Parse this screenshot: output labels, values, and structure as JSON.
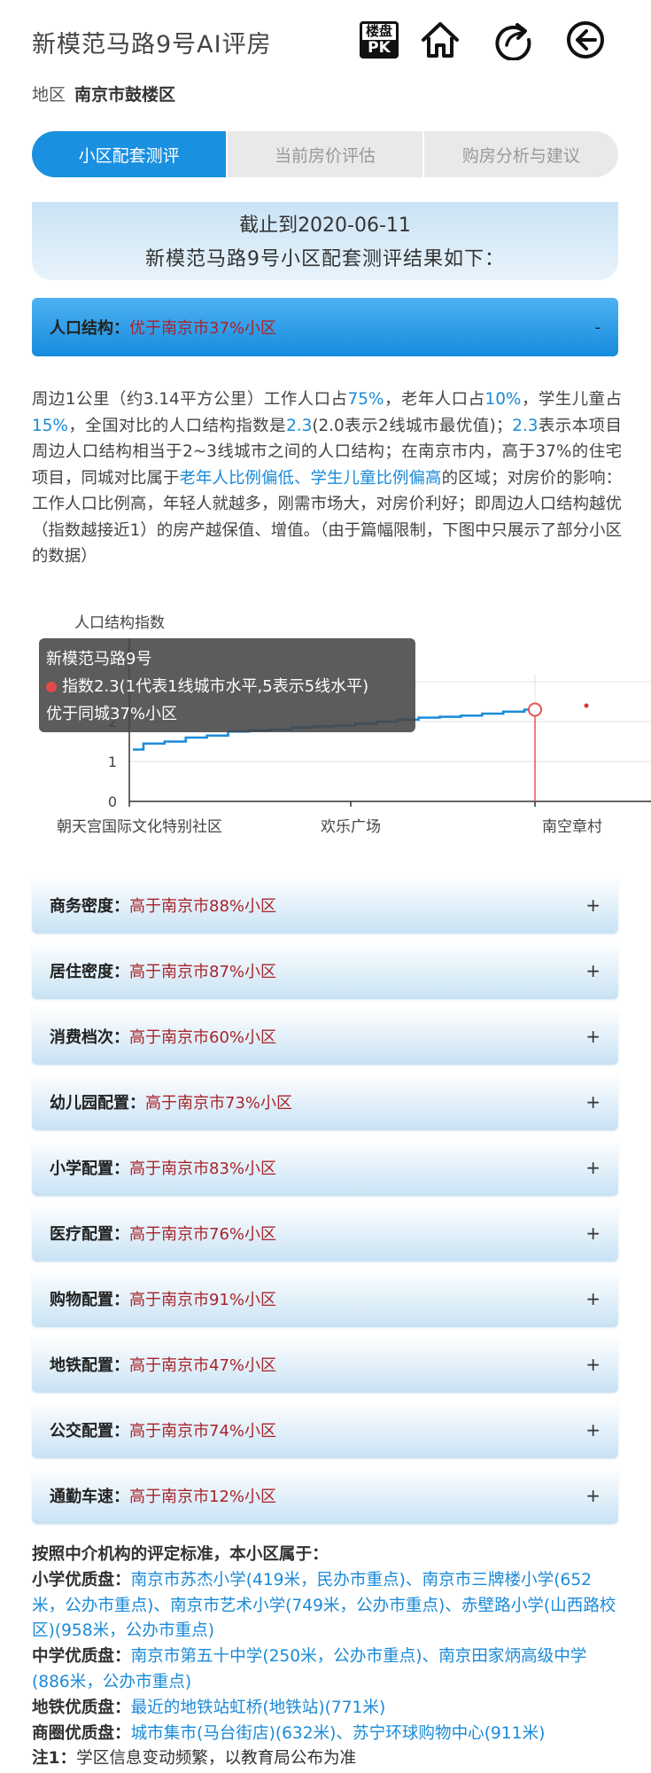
{
  "header": {
    "title": "新模范马路9号AI评房",
    "pk_icon_top": "楼盘",
    "pk_icon_bottom": "PK",
    "icons": [
      "pk-icon",
      "home-icon",
      "share-icon",
      "back-icon"
    ]
  },
  "region": {
    "label": "地区",
    "value": "南京市鼓楼区"
  },
  "tabs": [
    {
      "label": "小区配套测评",
      "active": true
    },
    {
      "label": "当前房价评估",
      "active": false
    },
    {
      "label": "购房分析与建议",
      "active": false
    }
  ],
  "summary": {
    "line1": "截止到2020-06-11",
    "line2": "新模范马路9号小区配套测评结果如下："
  },
  "population": {
    "label": "人口结构：",
    "value": "优于南京市37%小区",
    "sign": "-"
  },
  "description": {
    "p1": "周边1公里（约3.14平方公里）工作人口占",
    "work": "75%",
    "p2": "，老年人口占",
    "old": "10%",
    "p3": "，学生儿童占",
    "child": "15%",
    "p4": "，全国对比的人口结构指数是",
    "index1": "2.3",
    "p5": "(2.0表示2线城市最优值)；",
    "index2": "2.3",
    "p6": "表示本项目周边人口结构相当于2~3线城市之间的人口结构；在南京市内，高于37%的住宅项目，同城对比属于",
    "tag": "老年人比例偏低、学生儿童比例偏高",
    "p7": "的区域；对房价的影响：工作人口比例高，年轻人就越多，刚需市场大，对房价利好；即周边人口结构越优（指数越接近1）的房产越保值、增值。（由于篇幅限制，下图中只展示了部分小区的数据）"
  },
  "chart_data": {
    "type": "line",
    "ylabel": "人口结构指数",
    "ylim": [
      0,
      3
    ],
    "yticks": [
      "0",
      "1",
      "2"
    ],
    "categories": [
      "朝天宫国际文化特别社区",
      "欢乐广场",
      "南空章村"
    ],
    "series": [
      {
        "values": [
          1.3,
          1.45,
          1.5,
          1.6,
          1.65,
          1.75,
          1.78,
          1.8,
          1.85,
          1.88,
          1.9,
          1.95,
          2.0,
          2.05,
          2.1,
          2.12,
          2.15,
          2.2,
          2.25,
          2.3
        ]
      }
    ],
    "highlight": {
      "value": 2.3
    },
    "outlier": {
      "value": 2.4
    },
    "tooltip": {
      "name": "新模范马路9号",
      "line": "指数2.3(1代表1线城市水平,5表示5线水平)",
      "compare": "优于同城37%小区"
    },
    "colors": {
      "line": "#1b8cd8",
      "highlight": "#e05555",
      "marker": "#d33"
    }
  },
  "accordions": [
    {
      "label": "商务密度：",
      "value": "高于南京市88%小区",
      "sign": "+"
    },
    {
      "label": "居住密度：",
      "value": "高于南京市87%小区",
      "sign": "+"
    },
    {
      "label": "消费档次：",
      "value": "高于南京市60%小区",
      "sign": "+"
    },
    {
      "label": "幼儿园配置：",
      "value": "高于南京市73%小区",
      "sign": "+"
    },
    {
      "label": "小学配置：",
      "value": "高于南京市83%小区",
      "sign": "+"
    },
    {
      "label": "医疗配置：",
      "value": "高于南京市76%小区",
      "sign": "+"
    },
    {
      "label": "购物配置：",
      "value": "高于南京市91%小区",
      "sign": "+"
    },
    {
      "label": "地铁配置：",
      "value": "高于南京市47%小区",
      "sign": "+"
    },
    {
      "label": "公交配置：",
      "value": "高于南京市74%小区",
      "sign": "+"
    },
    {
      "label": "通勤车速：",
      "value": "高于南京市12%小区",
      "sign": "+"
    }
  ],
  "bottom": {
    "intro": "按照中介机构的评定标准，本小区属于：",
    "primary_label": "小学优质盘：",
    "primary_value": "南京市苏杰小学(419米，民办市重点)、南京市三牌楼小学(652米，公办市重点)、南京市艺术小学(749米，公办市重点)、赤壁路小学(山西路校区)(958米，公办市重点)",
    "middle_label": "中学优质盘：",
    "middle_value": "南京市第五十中学(250米，公办市重点)、南京田家炳高级中学(886米，公办市重点)",
    "metro_label": "地铁优质盘：",
    "metro_value": "最近的地铁站虹桥(地铁站)(771米)",
    "mall_label": "商圈优质盘：",
    "mall_value": "城市集市(马台街店)(632米)、苏宁环球购物中心(911米)",
    "note_label": "注1：",
    "note_value": "学区信息变动频繁，以教育局公布为准"
  }
}
